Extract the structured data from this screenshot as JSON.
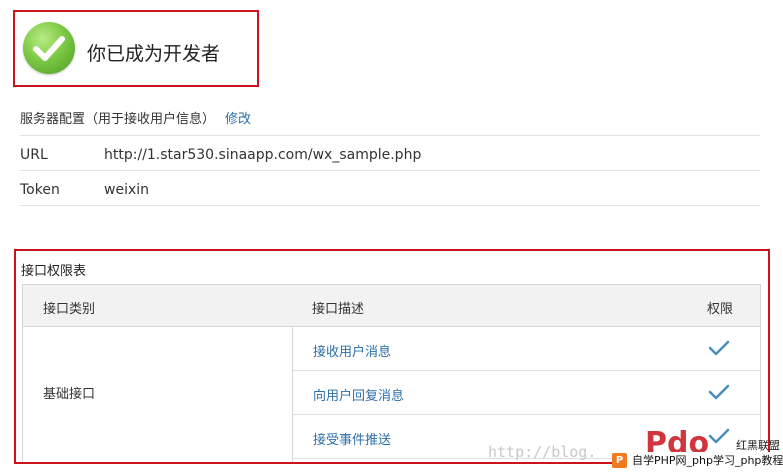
{
  "status": {
    "message": "你已成为开发者",
    "icon": "check-circle-icon"
  },
  "server_config": {
    "header": "服务器配置（用于接收用户信息）",
    "edit_label": "修改",
    "rows": [
      {
        "key": "URL",
        "value": "http://1.star530.sinaapp.com/wx_sample.php"
      },
      {
        "key": "Token",
        "value": "weixin"
      }
    ]
  },
  "permissions": {
    "title": "接口权限表",
    "columns": {
      "category": "接口类别",
      "description": "接口描述",
      "permission": "权限"
    },
    "category": "基础接口",
    "items": [
      {
        "label": "接收用户消息",
        "icon": "check-icon"
      },
      {
        "label": "向用户回复消息",
        "icon": "check-icon"
      },
      {
        "label": "接受事件推送",
        "icon": "check-icon"
      }
    ]
  },
  "watermark": {
    "url_text": "http://blog.",
    "logo_text": "Pdo",
    "brand": "红黑联盟",
    "bar_icon": "P",
    "bar_text": "自学PHP网_php学习_php教程"
  },
  "colors": {
    "accent_red": "#c9141d",
    "link_blue": "#2c6faa",
    "check_blue": "#4a90b8",
    "success_green": "#6abf3c"
  }
}
